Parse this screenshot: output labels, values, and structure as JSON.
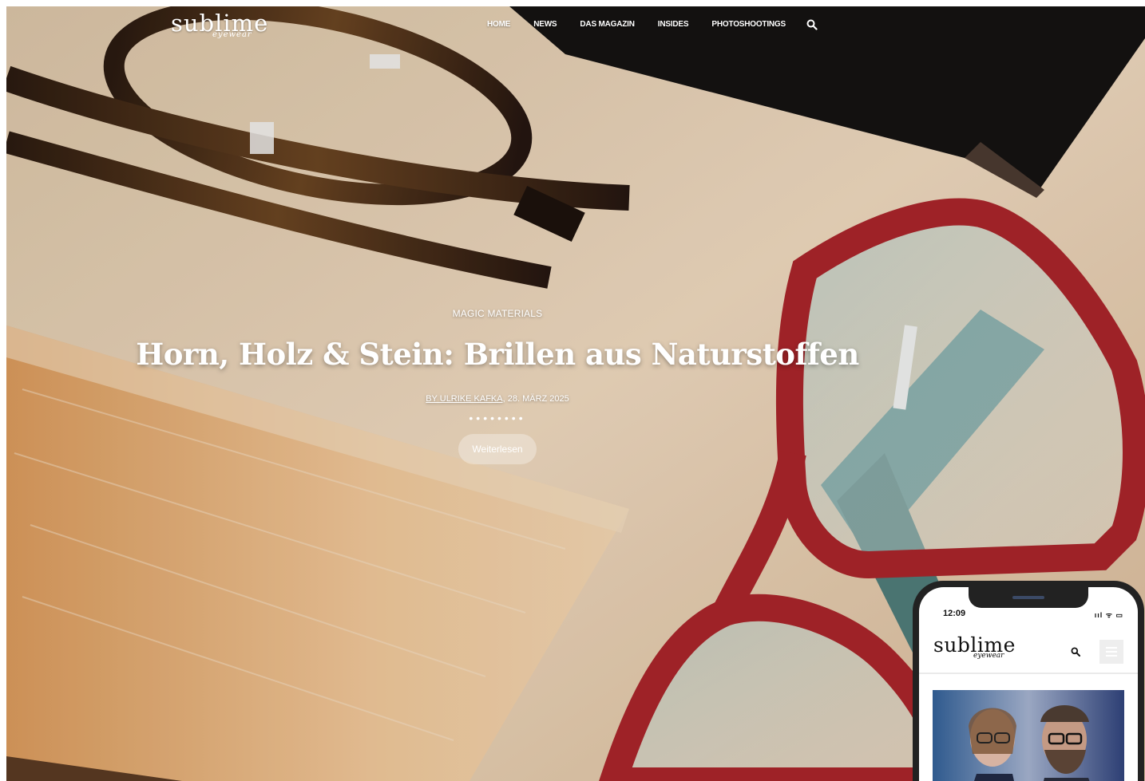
{
  "nav": {
    "logo_main": "sublime",
    "logo_sub": "eyewear",
    "items": [
      {
        "label": "HOME"
      },
      {
        "label": "NEWS"
      },
      {
        "label": "DAS MAGAZIN"
      },
      {
        "label": "INSIDES"
      },
      {
        "label": "PHOTOSHOOTINGS"
      }
    ],
    "search_icon": "search-icon"
  },
  "hero": {
    "category": "MAGIC MATERIALS",
    "title": "Horn, Holz & Stein: Brillen aus Naturstoffen",
    "author": "BY ULRIKE KAFKA",
    "date": ", 28. MÄRZ 2025",
    "dots": "••••••••",
    "button_label": "Weiterlesen"
  },
  "phone": {
    "time": "12:09",
    "status_icons": "ııl ᯤ ▭",
    "logo_main": "sublime",
    "logo_sub": "eyewear",
    "search_icon": "search-icon",
    "menu_icon": "hamburger-menu-icon"
  },
  "colors": {
    "accent_frame": "#b3262a",
    "background_table": "#e8d2b6",
    "text_on_hero": "#ffffff"
  }
}
